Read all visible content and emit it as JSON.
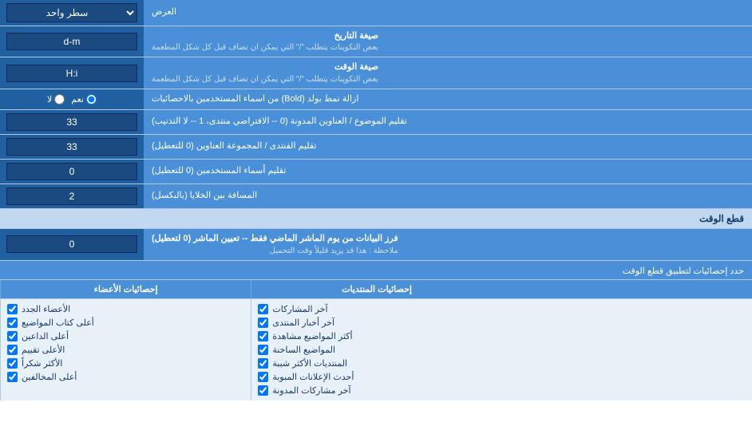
{
  "title": "العرض",
  "rows": [
    {
      "id": "row-lines",
      "label": "العرض",
      "input_type": "dropdown",
      "value": "سطر واحد",
      "label_side": "right"
    },
    {
      "id": "row-date-format",
      "label_main": "صيغة التاريخ",
      "label_sub": "بعض التكوينات يتطلب \"/\" التي يمكن ان تضاف قبل كل شكل المطعمة",
      "input_type": "text",
      "value": "d-m"
    },
    {
      "id": "row-time-format",
      "label_main": "صيغة الوقت",
      "label_sub": "بعض التكوينات يتطلب \"/\" التي يمكن ان تضاف قبل كل شكل المطعمة",
      "input_type": "text",
      "value": "H:i"
    },
    {
      "id": "row-bold",
      "label": "ازالة نمط بولد (Bold) من اسماء المستخدمين بالاحصائيات",
      "input_type": "radio",
      "options": [
        "نعم",
        "لا"
      ],
      "selected": "نعم"
    },
    {
      "id": "row-topics-titles",
      "label": "تقليم الموضوع / العناوين المدونة (0 -- الافتراضي منتدى، 1 -- لا التذنيب)",
      "input_type": "text",
      "value": "33"
    },
    {
      "id": "row-forum-group",
      "label": "تقليم الفنتدى / المجموعة العناوين (0 للتعطيل)",
      "input_type": "text",
      "value": "33"
    },
    {
      "id": "row-usernames",
      "label": "تقليم أسماء المستخدمين (0 للتعطيل)",
      "input_type": "text",
      "value": "0"
    },
    {
      "id": "row-spacing",
      "label": "المسافة بين الخلايا (بالبكسل)",
      "input_type": "text",
      "value": "2"
    }
  ],
  "section_cutoff": {
    "title": "قطع الوقت",
    "rows": [
      {
        "id": "row-cutoff-val",
        "label_main": "فرز البيانات من يوم الماشر الماضي فقط -- تعيين الماشر (0 لتعطيل)",
        "label_sub": "ملاحظة : هذا قد يزيد قليلاً وقت التحميل",
        "input_type": "text",
        "value": "0"
      }
    ]
  },
  "checkboxes": {
    "limit_label": "حدد إحصائيات لتطبيق قطع الوقت",
    "columns": [
      {
        "header": "",
        "items": []
      },
      {
        "header": "إحصائيات المنتديات",
        "items": [
          "آخر المشاركات",
          "آخر أخبار المنتدى",
          "أكثر المواضيع مشاهدة",
          "المواضيع الساخنة",
          "المنتديات الأكثر شببة",
          "أحدث الإعلانات المبوبة",
          "آخر مشاركات المدونة"
        ]
      },
      {
        "header": "إحصائيات الأعضاء",
        "items": [
          "الأعضاء الجدد",
          "أعلى كتاب المواضيع",
          "أعلى الداعين",
          "الأعلى تقييم",
          "الأكثر شكراً",
          "أعلى المخالفين"
        ]
      }
    ]
  }
}
